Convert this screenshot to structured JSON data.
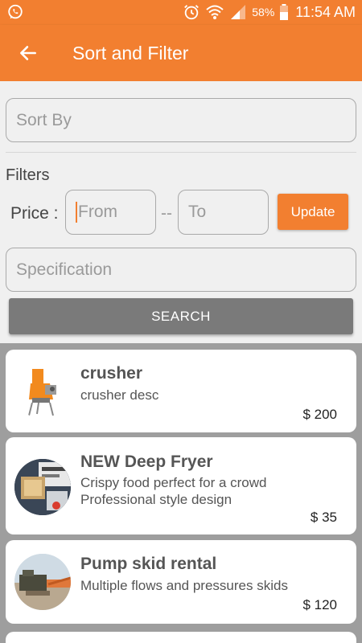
{
  "status_bar": {
    "battery_percent": "58%",
    "time": "11:54 AM",
    "icons": [
      "whatsapp-icon",
      "alarm-icon",
      "wifi-icon",
      "signal-icon",
      "battery-icon"
    ]
  },
  "app_bar": {
    "title": "Sort and Filter",
    "back_icon": "arrow-left-icon"
  },
  "filters": {
    "sort_by_placeholder": "Sort By",
    "section_label": "Filters",
    "price_label": "Price :",
    "price_from_placeholder": "From",
    "price_separator": "--",
    "price_to_placeholder": "To",
    "update_label": "Update",
    "specification_placeholder": "Specification",
    "search_label": "SEARCH"
  },
  "products": [
    {
      "name": "crusher",
      "description": "crusher desc",
      "price": "$ 200"
    },
    {
      "name": "NEW Deep Fryer",
      "description": "Crispy food perfect for a crowd\nProfessional style design",
      "price": "$ 35"
    },
    {
      "name": "Pump skid rental",
      "description": "Multiple flows and pressures skids",
      "price": "$ 120"
    }
  ],
  "colors": {
    "accent": "#f27f30",
    "search_button": "#7a7a7a",
    "list_background": "#9e9e9e"
  }
}
